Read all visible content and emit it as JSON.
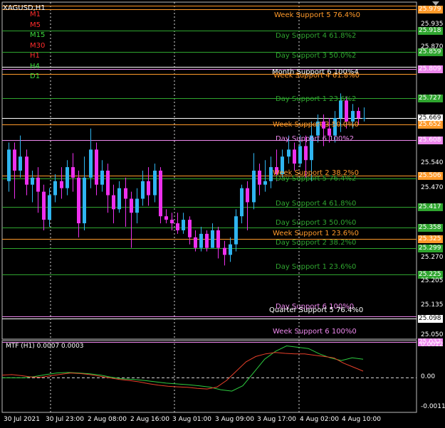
{
  "chart": {
    "symbol": "XAGUSD,H1",
    "timeframes": [
      {
        "label": "M1",
        "color": "#ff2b2b"
      },
      {
        "label": "M5",
        "color": "#ff2b2b"
      },
      {
        "label": "M15",
        "color": "#3cdc3c"
      },
      {
        "label": "M30",
        "color": "#ff2b2b"
      },
      {
        "label": "H1",
        "color": "#ff2b2b"
      },
      {
        "label": "H4",
        "color": "#3cdc3c"
      },
      {
        "label": "D1",
        "color": "#3cdc3c"
      }
    ],
    "price_labels": [
      "25.935",
      "25.870",
      "25.540",
      "25.470",
      "25.270",
      "25.205",
      "25.135",
      "25.050"
    ],
    "price_tags": [
      {
        "text": "25.979",
        "color": "#ff9a2a"
      },
      {
        "text": "25.918",
        "color": "#2fa52f"
      },
      {
        "text": "25.859",
        "color": "#2fa52f"
      },
      {
        "text": "25.809",
        "color": "#ee88ee"
      },
      {
        "text": "25.727",
        "color": "#2fa52f"
      },
      {
        "text": "25.669",
        "color": "#ffffff"
      },
      {
        "text": "25.652",
        "color": "#ff9a2a"
      },
      {
        "text": "25.608",
        "color": "#ee88ee"
      },
      {
        "text": "25.506",
        "color": "#ff9a2a"
      },
      {
        "text": "25.417",
        "color": "#2fa52f"
      },
      {
        "text": "25.358",
        "color": "#2fa52f"
      },
      {
        "text": "25.325",
        "color": "#ff9a2a"
      },
      {
        "text": "25.299",
        "color": "#2fa52f"
      },
      {
        "text": "25.225",
        "color": "#2fa52f"
      },
      {
        "text": "25.098",
        "color": "#ffffff"
      },
      {
        "text": "25.032",
        "color": "#ee88ee"
      }
    ],
    "level_labels": [
      {
        "text": "Week Support 5 76.4%0",
        "color": "#ff9a2a"
      },
      {
        "text": "Day Support 4 61.8%2",
        "color": "#2fa52f"
      },
      {
        "text": "Day Support 3 50.0%2",
        "color": "#2fa52f"
      },
      {
        "text": "Month Support 6 100%4",
        "color": "#ffffff"
      },
      {
        "text": "Week Support 4 61.8%0",
        "color": "#ff9a2a"
      },
      {
        "text": "Day Support 1 23.6%2",
        "color": "#2fa52f"
      },
      {
        "text": "Week Support 3 50.0%0",
        "color": "#ff9a2a"
      },
      {
        "text": "Day Support 6 100%2",
        "color": "#ee88ee"
      },
      {
        "text": "Week Support 2 38.2%0",
        "color": "#ff9a2a"
      },
      {
        "text": "Day Support 5 76.4%2",
        "color": "#2fa52f"
      },
      {
        "text": "Day Support 4 61.8%0",
        "color": "#2fa52f"
      },
      {
        "text": "Day Support 3 50.0%0",
        "color": "#2fa52f"
      },
      {
        "text": "Week Support 1 23.6%0",
        "color": "#ff9a2a"
      },
      {
        "text": "Day Support 2 38.2%0",
        "color": "#2fa52f"
      },
      {
        "text": "Day Support 1 23.6%0",
        "color": "#2fa52f"
      },
      {
        "text": "Day Support 6 100%0",
        "color": "#ee88ee"
      },
      {
        "text": "Quarter Support 5 76.4%0",
        "color": "#ffffff"
      },
      {
        "text": "Week Support 6 100%0",
        "color": "#ee88ee"
      }
    ],
    "time_labels": [
      "30 Jul 2021",
      "30 Jul 23:00",
      "2 Aug 08:00",
      "2 Aug 16:00",
      "3 Aug 01:00",
      "3 Aug 09:00",
      "3 Aug 17:00",
      "4 Aug 02:00",
      "4 Aug 10:00"
    ],
    "indicator": {
      "title": "MTF (H1) 0.0007 0.0003",
      "scale_labels": [
        "0.0012",
        "0.00",
        "-0.0011"
      ],
      "series": [
        {
          "name": "main",
          "color": "#2ecc40",
          "values": [
            0,
            0,
            0,
            5e-05,
            0.00012,
            0.00018,
            0.0002,
            0.00018,
            0.00015,
            0.0001,
            2e-05,
            -4e-05,
            -6e-05,
            -0.0001,
            -0.00015,
            -0.0002,
            -0.00023,
            -0.00026,
            -0.0003,
            -0.00035,
            -0.00045,
            -0.0005,
            -0.0003,
            0.0002,
            0.0007,
            0.001,
            0.0012,
            0.00115,
            0.0011,
            0.0009,
            0.00075,
            0.00065,
            0.00075,
            0.0007
          ]
        },
        {
          "name": "signal",
          "color": "#e8402a",
          "values": [
            0.0001,
            0.00012,
            8e-05,
            3e-05,
            2e-05,
            8e-05,
            0.00013,
            0.00018,
            0.00016,
            0.00012,
            6e-05,
            0.0,
            -6e-05,
            -0.0001,
            -0.00015,
            -0.00022,
            -0.00028,
            -0.00032,
            -0.00034,
            -0.00036,
            -0.0004,
            -0.00042,
            -0.00035,
            -0.0001,
            0.00025,
            0.0006,
            0.0008,
            0.0009,
            0.00095,
            0.00092,
            0.0009,
            0.0009,
            0.00085,
            0.0008,
            0.00075,
            0.00055,
            0.0004,
            0.00025
          ]
        }
      ]
    },
    "candles": [
      [
        25.49,
        25.58,
        25.46,
        25.6
      ],
      [
        25.58,
        25.52,
        25.44,
        25.6
      ],
      [
        25.52,
        25.56,
        25.5,
        25.62
      ],
      [
        25.56,
        25.48,
        25.45,
        25.58
      ],
      [
        25.48,
        25.5,
        25.43,
        25.52
      ],
      [
        25.5,
        25.46,
        25.4,
        25.53
      ],
      [
        25.46,
        25.38,
        25.35,
        25.48
      ],
      [
        25.38,
        25.45,
        25.36,
        25.47
      ],
      [
        25.45,
        25.49,
        25.43,
        25.51
      ],
      [
        25.49,
        25.47,
        25.44,
        25.53
      ],
      [
        25.47,
        25.53,
        25.45,
        25.55
      ],
      [
        25.53,
        25.5,
        25.46,
        25.57
      ],
      [
        25.5,
        25.37,
        25.33,
        25.52
      ],
      [
        25.37,
        25.5,
        25.35,
        25.56
      ],
      [
        25.5,
        25.58,
        25.47,
        25.64
      ],
      [
        25.58,
        25.48,
        25.45,
        25.6
      ],
      [
        25.48,
        25.52,
        25.46,
        25.55
      ],
      [
        25.52,
        25.45,
        25.4,
        25.54
      ],
      [
        25.45,
        25.41,
        25.37,
        25.48
      ],
      [
        25.41,
        25.47,
        25.4,
        25.49
      ],
      [
        25.47,
        25.44,
        25.36,
        25.5
      ],
      [
        25.44,
        25.4,
        25.3,
        25.46
      ],
      [
        25.4,
        25.44,
        25.37,
        25.47
      ],
      [
        25.44,
        25.49,
        25.42,
        25.52
      ],
      [
        25.49,
        25.45,
        25.42,
        25.53
      ],
      [
        25.45,
        25.52,
        25.43,
        25.54
      ],
      [
        25.52,
        25.39,
        25.37,
        25.53
      ],
      [
        25.39,
        25.38,
        25.37,
        25.41
      ],
      [
        25.38,
        25.37,
        25.35,
        25.4
      ],
      [
        25.37,
        25.35,
        25.34,
        25.4
      ],
      [
        25.35,
        25.38,
        25.34,
        25.4
      ],
      [
        25.38,
        25.33,
        25.31,
        25.39
      ],
      [
        25.33,
        25.3,
        25.29,
        25.35
      ],
      [
        25.3,
        25.34,
        25.29,
        25.36
      ],
      [
        25.34,
        25.3,
        25.29,
        25.35
      ],
      [
        25.3,
        25.35,
        25.3,
        25.37
      ],
      [
        25.35,
        25.3,
        25.27,
        25.36
      ],
      [
        25.3,
        25.28,
        25.25,
        25.32
      ],
      [
        25.28,
        25.31,
        25.26,
        25.33
      ],
      [
        25.31,
        25.39,
        25.29,
        25.41
      ],
      [
        25.39,
        25.47,
        25.37,
        25.48
      ],
      [
        25.47,
        25.43,
        25.35,
        25.49
      ],
      [
        25.43,
        25.52,
        25.41,
        25.57
      ],
      [
        25.52,
        25.48,
        25.45,
        25.54
      ],
      [
        25.48,
        25.49,
        25.46,
        25.55
      ],
      [
        25.49,
        25.53,
        25.47,
        25.56
      ],
      [
        25.53,
        25.51,
        25.49,
        25.58
      ],
      [
        25.51,
        25.56,
        25.5,
        25.58
      ],
      [
        25.56,
        25.58,
        25.54,
        25.62
      ],
      [
        25.58,
        25.54,
        25.52,
        25.6
      ],
      [
        25.54,
        25.59,
        25.53,
        25.62
      ],
      [
        25.59,
        25.55,
        25.5,
        25.62
      ],
      [
        25.55,
        25.62,
        25.49,
        25.66
      ],
      [
        25.62,
        25.66,
        25.6,
        25.68
      ],
      [
        25.66,
        25.64,
        25.59,
        25.68
      ],
      [
        25.64,
        25.62,
        25.6,
        25.67
      ],
      [
        25.62,
        25.67,
        25.6,
        25.69
      ],
      [
        25.67,
        25.72,
        25.63,
        25.74
      ],
      [
        25.72,
        25.66,
        25.64,
        25.73
      ],
      [
        25.66,
        25.69,
        25.64,
        25.71
      ],
      [
        25.69,
        25.67,
        25.65,
        25.7
      ],
      [
        25.67,
        25.67,
        25.66,
        25.7
      ]
    ]
  }
}
